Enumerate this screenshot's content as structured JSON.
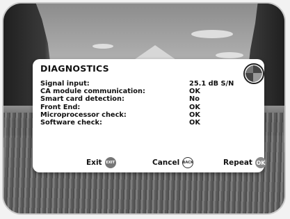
{
  "dialog": {
    "title": "DIAGNOSTICS",
    "rows": [
      {
        "label": "Signal input:",
        "value": "25.1 dB S/N"
      },
      {
        "label": "CA module communication:",
        "value": "OK"
      },
      {
        "label": "Smart card detection:",
        "value": "No"
      },
      {
        "label": "Front End:",
        "value": "OK"
      },
      {
        "label": "Microprocessor check:",
        "value": "OK"
      },
      {
        "label": "Software check:",
        "value": "OK"
      }
    ],
    "buttons": {
      "exit": {
        "label": "Exit",
        "key": "EXIT"
      },
      "cancel": {
        "label": "Cancel",
        "key": "BACK"
      },
      "repeat": {
        "label": "Repeat",
        "key": "OK"
      }
    }
  },
  "icons": {
    "status": "signal-quality-indicator-icon",
    "exit_key": "exit-key-icon",
    "back_key": "back-key-icon",
    "ok_key": "ok-key-icon"
  }
}
